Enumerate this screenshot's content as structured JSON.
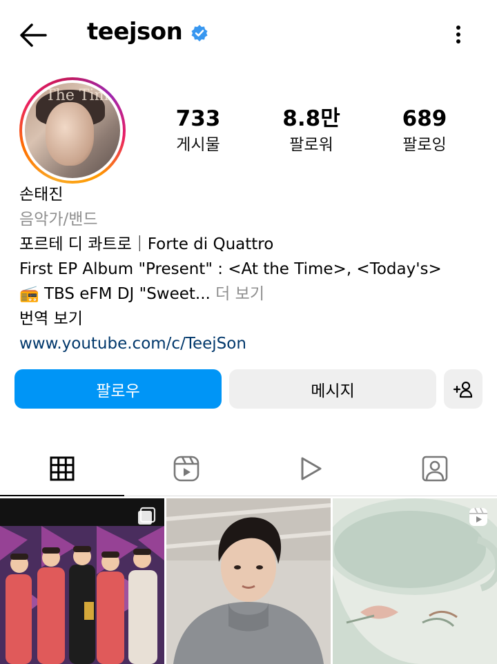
{
  "header": {
    "username": "teejson",
    "back_icon": "arrow-left-icon",
    "verified_icon": "verified-badge-icon",
    "more_icon": "more-vertical-icon"
  },
  "stats": [
    {
      "value": "733",
      "label": "게시물"
    },
    {
      "value": "8.8만",
      "label": "팔로워"
    },
    {
      "value": "689",
      "label": "팔로잉"
    }
  ],
  "profile": {
    "name": "손태진",
    "category": "음악가/밴드",
    "bio_line1": "포르테 디 콰트로｜Forte di Quattro",
    "bio_line2": "First EP Album \"Present\" : <At the Time>, <Today's>",
    "bio_line3_emoji": "📻",
    "bio_line3_text": " TBS eFM DJ \"Sweet...",
    "more_label": " 더 보기",
    "translate_label": "번역 보기",
    "link": "www.youtube.com/c/TeejSon",
    "avatar_text": "The Tim"
  },
  "buttons": {
    "follow": "팔로우",
    "message": "메시지",
    "add_user_icon": "add-person-icon"
  },
  "tabs": [
    {
      "icon": "grid-icon",
      "active": true
    },
    {
      "icon": "reels-icon",
      "active": false
    },
    {
      "icon": "play-icon",
      "active": false
    },
    {
      "icon": "tagged-icon",
      "active": false
    }
  ],
  "posts": [
    {
      "badge": "carousel-icon"
    },
    {
      "badge": ""
    },
    {
      "badge": "reels-icon"
    }
  ],
  "colors": {
    "accent": "#0095f6",
    "link": "#00376b",
    "verified": "#3897f0",
    "secondary_text": "#8e8e8e",
    "button_gray": "#efefef"
  }
}
